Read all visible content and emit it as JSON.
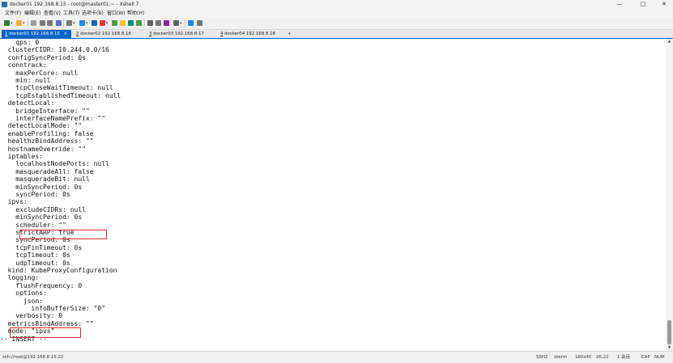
{
  "window": {
    "title": "docker01 192.168.8.15 - root@master01:~ - Xshell 7",
    "controls": {
      "minimize": "—",
      "maximize": "□",
      "close": "✕"
    }
  },
  "menu": [
    "文件(F)",
    "编辑(E)",
    "查看(V)",
    "工具(T)",
    "选项卡(B)",
    "窗口(W)",
    "帮助(H)"
  ],
  "toolbar_icons": [
    {
      "name": "new-session-icon",
      "color": "#2e7d32"
    },
    {
      "name": "open-folder-icon",
      "color": "#f2b134"
    },
    {
      "name": "link-icon",
      "color": "#9e9e9e"
    },
    {
      "name": "copy-icon",
      "color": "#7a7a7a"
    },
    {
      "name": "paste-icon",
      "color": "#7a7a7a"
    },
    {
      "name": "find-icon",
      "color": "#5c6bc0"
    },
    {
      "name": "print-icon",
      "color": "#7a7a7a"
    },
    {
      "name": "globe-icon",
      "color": "#1e88e5"
    },
    {
      "name": "font-icon",
      "color": "#1565c0"
    },
    {
      "name": "color-icon",
      "color": "#e53935"
    },
    {
      "name": "xftp-icon",
      "color": "#43a047"
    },
    {
      "name": "lock-icon",
      "color": "#fbc02d"
    },
    {
      "name": "fullscreen-icon",
      "color": "#00897b"
    },
    {
      "name": "transfer-icon",
      "color": "#43a047"
    },
    {
      "name": "keyboard-icon",
      "color": "#616161"
    },
    {
      "name": "compose-icon",
      "color": "#757575"
    },
    {
      "name": "script-icon",
      "color": "#8e24aa"
    },
    {
      "name": "layout-icon",
      "color": "#616161"
    },
    {
      "name": "help-icon",
      "color": "#1e88e5"
    },
    {
      "name": "options-icon",
      "color": "#757575"
    }
  ],
  "tabs": [
    {
      "num": "1",
      "label": "docker01 192.168.8.15",
      "active": true
    },
    {
      "num": "2",
      "label": "docker02 192.168.8.16",
      "active": false
    },
    {
      "num": "3",
      "label": "docker03 192.168.8.17",
      "active": false
    },
    {
      "num": "4",
      "label": "docker04 192.168.8.18",
      "active": false
    }
  ],
  "tab_close": "×",
  "tab_add": "+",
  "terminal": {
    "lines": [
      "    qps: 0",
      "  clusterCIDR: 10.244.0.0/16",
      "  configSyncPeriod: 0s",
      "  conntrack:",
      "    maxPerCore: null",
      "    min: null",
      "    tcpCloseWaitTimeout: null",
      "    tcpEstablishedTimeout: null",
      "  detectLocal:",
      "    bridgeInterface: \"\"",
      "    interfaceNamePrefix: \"\"",
      "  detectLocalMode: \"\"",
      "  enableProfiling: false",
      "  healthzBindAddress: \"\"",
      "  hostnameOverride: \"\"",
      "  iptables:",
      "    localhostNodePorts: null",
      "    masqueradeAll: false",
      "    masqueradeBit: null",
      "    minSyncPeriod: 0s",
      "    syncPeriod: 0s",
      "  ipvs:",
      "    excludeCIDRs: null",
      "    minSyncPeriod: 0s",
      "    scheduler: \"\"",
      "    strictARP: true",
      "    syncPeriod: 0s",
      "    tcpFinTimeout: 0s",
      "    tcpTimeout: 0s",
      "    udpTimeout: 0s",
      "  kind: KubeProxyConfiguration",
      "  logging:",
      "    flushFrequency: 0",
      "    options:",
      "      json:",
      "        infoBufferSize: \"0\"",
      "    verbosity: 0",
      "  metricsBindAddress: \"\"",
      "  mode: \"ipvs\"",
      "-- INSERT --"
    ],
    "highlight_color": "#e03030"
  },
  "status": {
    "connection": "ssh://root@192.168.8.15:22",
    "protocol": "SSH2",
    "term": "xterm",
    "size": "180x40",
    "cursor": "26,22",
    "sessions": "1 会话",
    "caps": "CAP",
    "num": "NUM"
  }
}
